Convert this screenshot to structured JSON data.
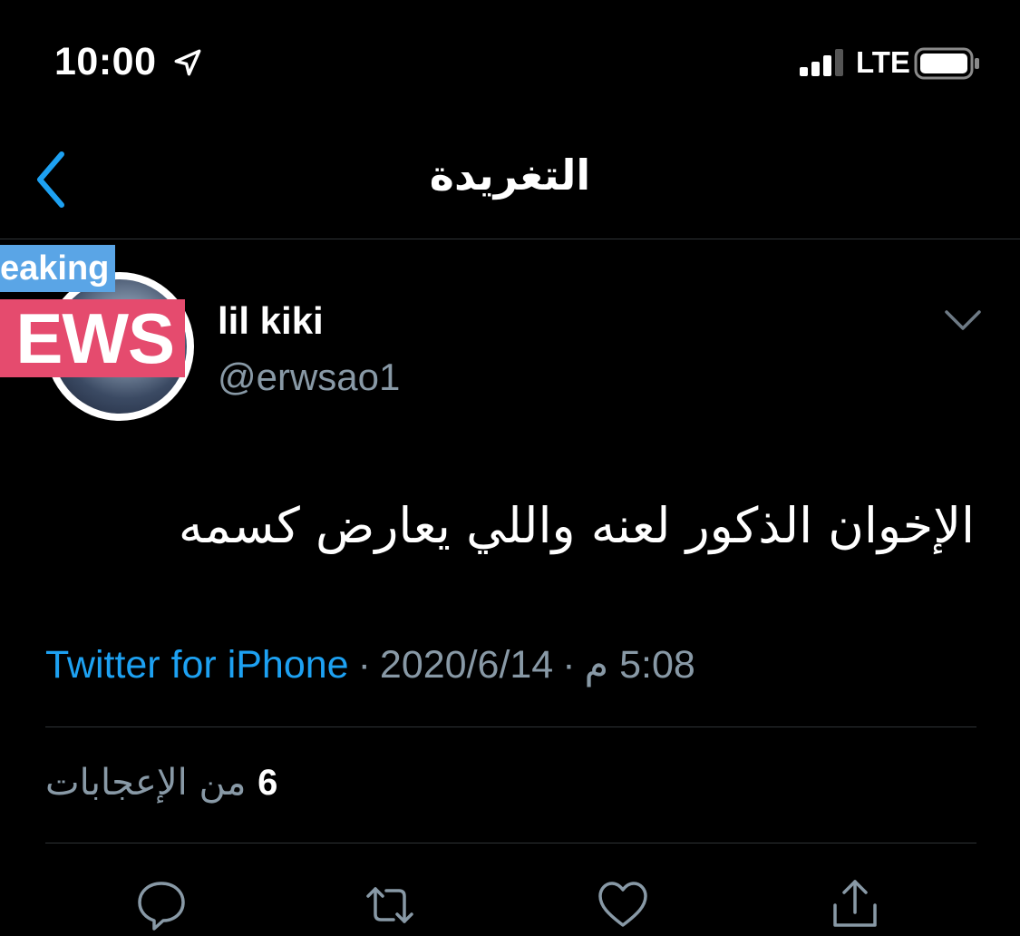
{
  "status_bar": {
    "time": "10:00",
    "network": "LTE",
    "location_icon": "location-arrow-icon",
    "signal_icon": "cellular-signal-icon",
    "battery_icon": "battery-icon"
  },
  "header": {
    "title": "التغريدة",
    "back_icon": "chevron-left-icon"
  },
  "avatar": {
    "badge_top": "eaking",
    "badge_bottom": "EWS"
  },
  "user": {
    "display_name": "lil kiki",
    "username": "@erwsao1"
  },
  "tweet": {
    "text": "الإخوان الذكور لعنه واللي يعارض كسمه",
    "source": "Twitter for iPhone",
    "date": "2020/6/14",
    "time": "5:08 م",
    "separator": "·"
  },
  "likes": {
    "count": "6",
    "label": "من الإعجابات"
  },
  "actions": [
    "reply-icon",
    "retweet-icon",
    "like-icon",
    "share-icon"
  ],
  "colors": {
    "background": "#000000",
    "accent": "#1da1f2",
    "secondary_text": "#8899a6",
    "divider": "#2f3336",
    "badge_blue": "#5aa5e6",
    "badge_red": "#e54b6e"
  }
}
